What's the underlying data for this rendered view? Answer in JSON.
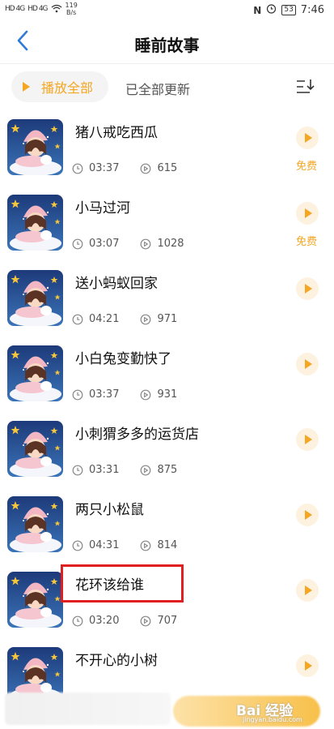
{
  "status": {
    "carrier1": "HD 4G",
    "carrier2": "HD 4G",
    "speed_value": "119",
    "speed_unit": "B/s",
    "battery": "53",
    "time": "7:46"
  },
  "header": {
    "title": "睡前故事",
    "back_icon": "chevron-left-icon"
  },
  "toolbar": {
    "play_all_label": "播放全部",
    "updated_label": "已全部更新",
    "sort_icon": "sort-icon"
  },
  "accent_color": "#f5a623",
  "stories": [
    {
      "title": "猪八戒吃西瓜",
      "duration": "03:37",
      "plays": "615",
      "badge": "免费"
    },
    {
      "title": "小马过河",
      "duration": "03:07",
      "plays": "1028",
      "badge": "免费"
    },
    {
      "title": "送小蚂蚁回家",
      "duration": "04:21",
      "plays": "971",
      "badge": ""
    },
    {
      "title": "小白兔变勤快了",
      "duration": "03:37",
      "plays": "931",
      "badge": ""
    },
    {
      "title": "小刺猬多多的运货店",
      "duration": "03:31",
      "plays": "875",
      "badge": ""
    },
    {
      "title": "两只小松鼠",
      "duration": "04:31",
      "plays": "814",
      "badge": ""
    },
    {
      "title": "花环该给谁",
      "duration": "03:20",
      "plays": "707",
      "badge": ""
    },
    {
      "title": "不开心的小树",
      "duration": "",
      "plays": "",
      "badge": ""
    }
  ],
  "watermark": {
    "text": "Bai 经验",
    "sub": "jingyan.baidu.com"
  }
}
